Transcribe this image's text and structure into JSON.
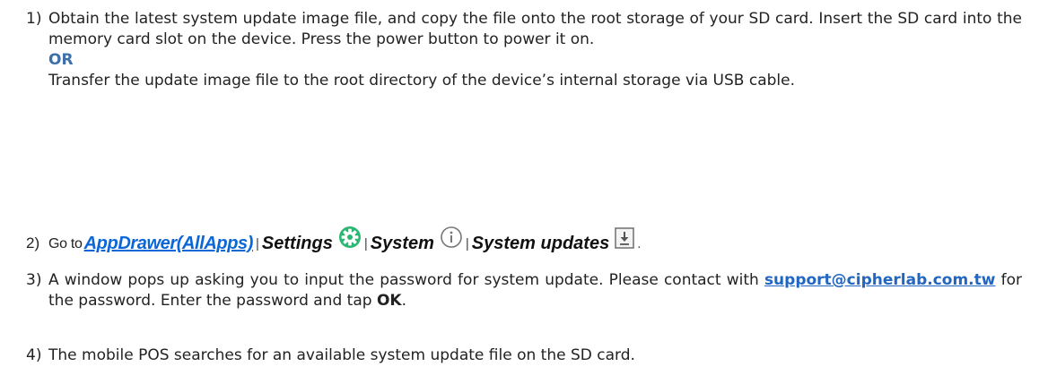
{
  "steps": [
    {
      "number": "1)",
      "text": "Obtain the latest system update image file, and copy the file onto the root storage of your SD card. Insert the SD card into the memory card slot on the device. Press the power button to power it on.",
      "or_label": "OR",
      "alt_text": "Transfer the update image file to the root directory of the device’s internal storage via USB cable."
    },
    {
      "number": "2)",
      "prefix": "Go to",
      "link": "AppDrawer(AllApps)",
      "sep": "|",
      "settings": "Settings",
      "system": "System",
      "system_updates": "System updates",
      "end": "."
    },
    {
      "number": "3)",
      "text_a": "A window pops up asking you to input the password for system update. Please contact with ",
      "email": "support@cipherlab.com.tw",
      "text_b": " for the password. Enter the password and tap ",
      "ok": "OK",
      "text_c": "."
    },
    {
      "number": "4)",
      "text": "The mobile POS searches for an available system update file on the SD card."
    }
  ],
  "icons": {
    "settings": "settings-gear-icon",
    "system": "info-circle-icon",
    "updates": "system-update-download-icon"
  },
  "colors": {
    "link": "#0b66d8",
    "or": "#3d6fa8",
    "settings_icon": "#2bb673"
  }
}
